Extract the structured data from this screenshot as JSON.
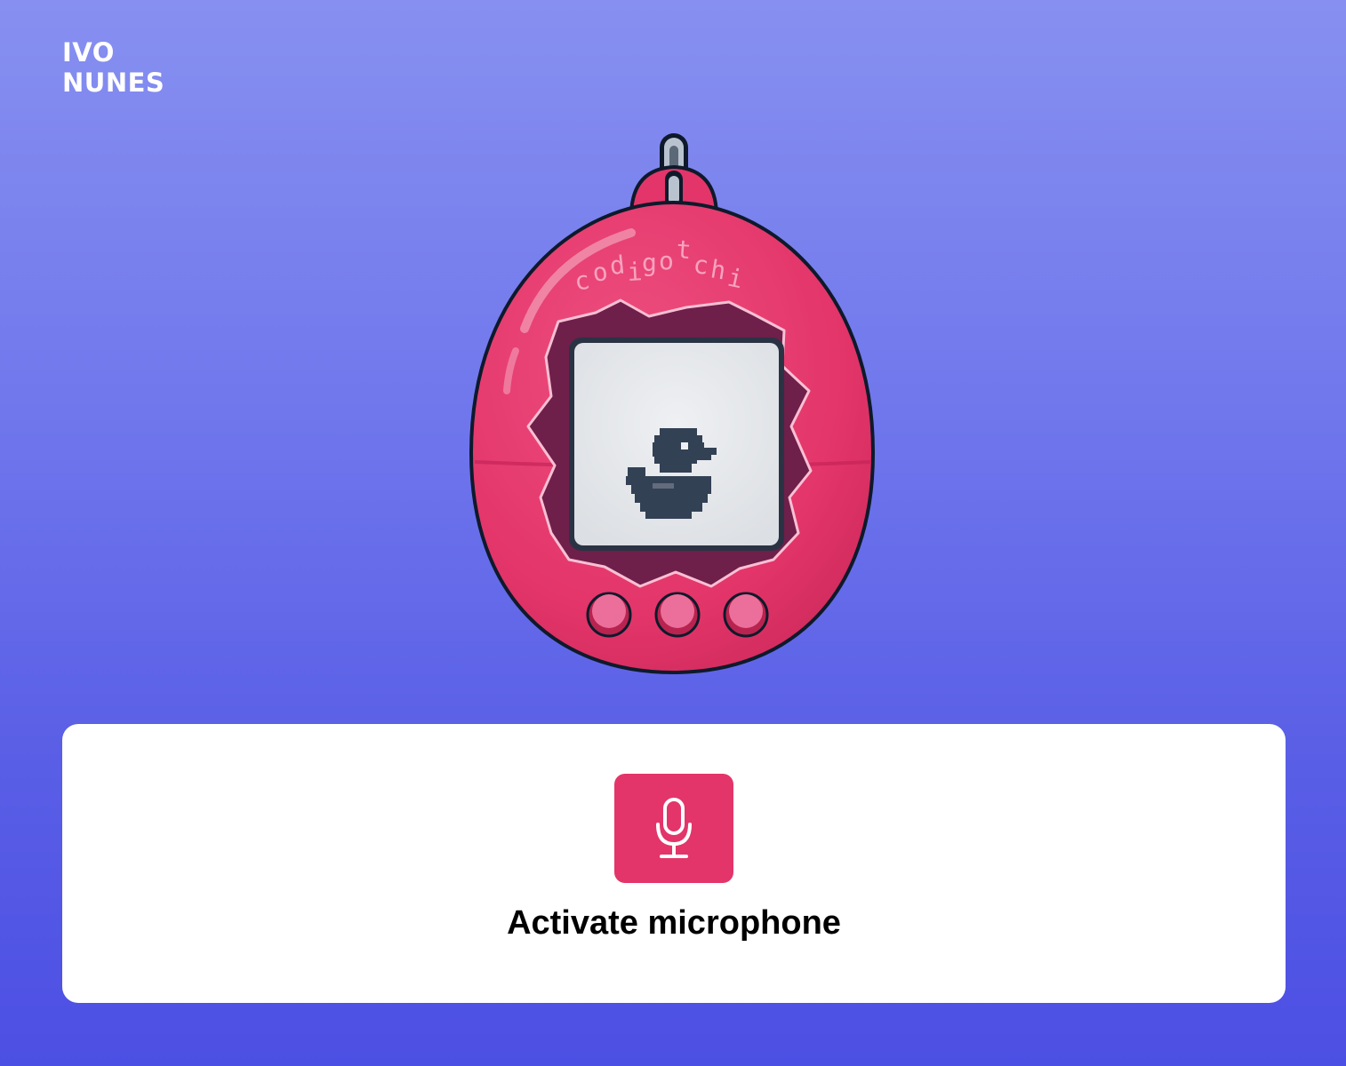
{
  "brand": {
    "line1": "IVO",
    "line2": "NUNES"
  },
  "device": {
    "name": "codigotchi",
    "body_color": "#e3356a",
    "screen_color": "#b8c4d9",
    "pet_color": "#334155",
    "buttons_count": 3
  },
  "microphone": {
    "button_icon": "microphone-icon",
    "label": "Activate microphone",
    "accent_color": "#e3356a"
  }
}
